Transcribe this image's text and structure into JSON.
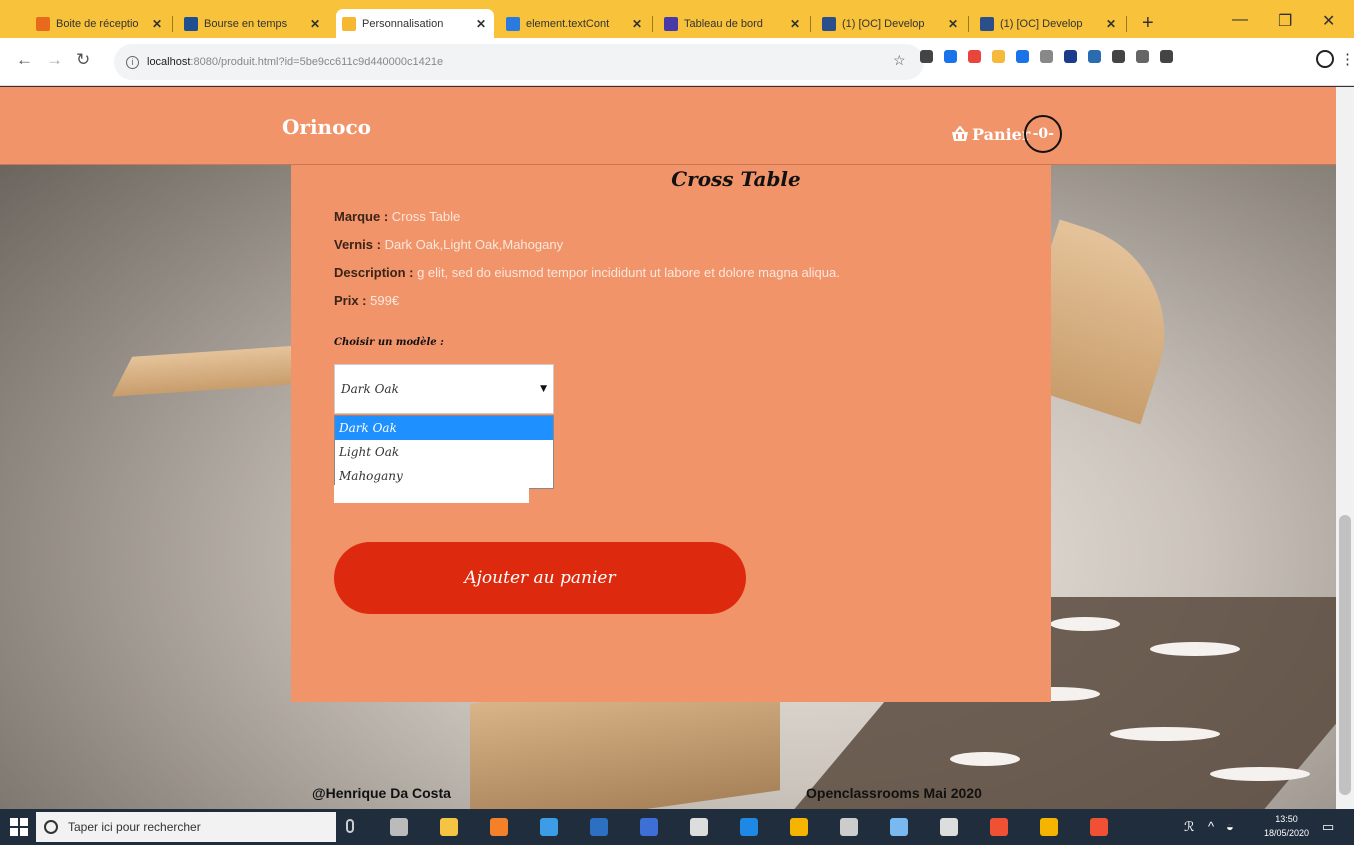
{
  "browser": {
    "tabs": [
      {
        "label": "Boite de réceptio",
        "favicon_color": "#e86a1c",
        "active": false
      },
      {
        "label": "Bourse en temps",
        "favicon_color": "#1d4f91",
        "active": false
      },
      {
        "label": "Personnalisation",
        "favicon_color": "#f7b731",
        "active": true
      },
      {
        "label": "element.textCont",
        "favicon_color": "#2a7ae2",
        "active": false
      },
      {
        "label": "Tableau de bord",
        "favicon_color": "#4a3aa8",
        "active": false
      },
      {
        "label": "(1) [OC] Develop",
        "favicon_color": "#2b4f8a",
        "active": false
      },
      {
        "label": "(1) [OC] Develop",
        "favicon_color": "#2b4f8a",
        "active": false
      }
    ],
    "close_glyph": "✕",
    "new_tab_glyph": "+",
    "url_host": "localhost",
    "url_path": ":8080/produit.html?id=5be9cc611c9d440000c1421e",
    "window_controls": {
      "minimize": "—",
      "maximize": "❐",
      "close": "✕"
    },
    "extension_colors": [
      "#444444",
      "#1a73e8",
      "#e8453c",
      "#f6b93b",
      "#1a73e8",
      "#888888",
      "#1a3c8a",
      "#2b6cb0",
      "#444444",
      "#666666",
      "#444444"
    ]
  },
  "site": {
    "logo": "Orinoco",
    "cart_label": "Panier",
    "cart_count": "-0-",
    "product": {
      "name": "Cross Table",
      "brand_label": "Marque :",
      "brand_value": "Cross Table",
      "varnish_label": "Vernis :",
      "varnish_value": "Dark Oak,Light Oak,Mahogany",
      "description_label": "Description :",
      "description_value": "g elit, sed do eiusmod tempor incididunt ut labore et dolore magna aliqua.",
      "price_label": "Prix :",
      "price_value": "599€"
    },
    "model_label": "Choisir un modèle :",
    "select_value": "Dark Oak",
    "options": [
      "Dark Oak",
      "Light Oak",
      "Mahogany"
    ],
    "add_button": "Ajouter au panier",
    "footer_author": "@Henrique Da Costa",
    "footer_course": "Openclassrooms Mai 2020"
  },
  "taskbar": {
    "search_placeholder": "Taper ici pour rechercher",
    "time": "13:50",
    "date": "18/05/2020",
    "app_icon_colors": [
      "#bbbbbb",
      "#f6c443",
      "#f4802a",
      "#3c9de6",
      "#2d6fc0",
      "#3d6fd6",
      "#dddddd",
      "#1e88e5",
      "#f4b400",
      "#cccccc",
      "#7ab8f0",
      "#dddddd",
      "#f05033",
      "#f4b400",
      "#f05033"
    ]
  }
}
